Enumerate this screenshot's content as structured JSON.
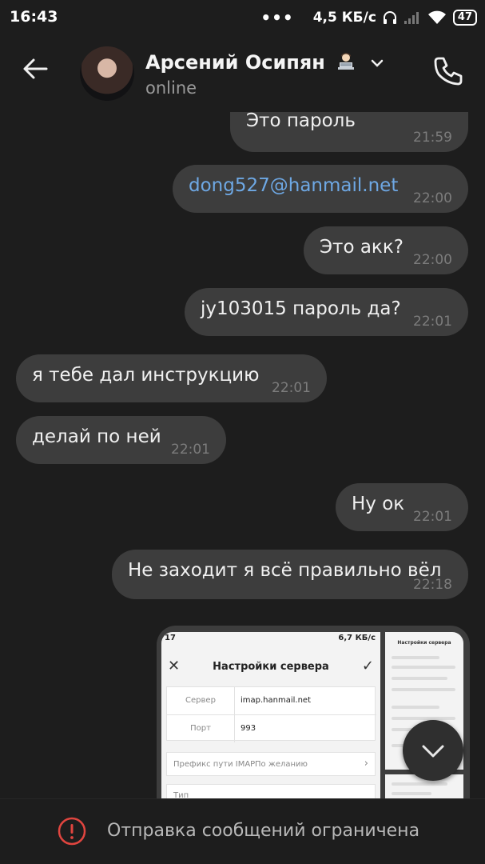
{
  "status_bar": {
    "time": "16:43",
    "dots": "•••",
    "network_speed": "4,5 КБ/с",
    "battery": "47"
  },
  "header": {
    "name": "Арсений Осипян",
    "status": "online",
    "name_emoji": "technologist-emoji"
  },
  "messages": [
    {
      "text": "Это пароль",
      "time": "21:59",
      "side": "out"
    },
    {
      "text": "dong527@hanmail.net",
      "time": "22:00",
      "side": "out",
      "link": true
    },
    {
      "text": "Это акк?",
      "time": "22:00",
      "side": "out"
    },
    {
      "text": "jy103015 пароль да?",
      "time": "22:01",
      "side": "out"
    },
    {
      "text": "я тебе дал инструкцию",
      "time": "22:01",
      "side": "in"
    },
    {
      "text": "делай по ней",
      "time": "22:01",
      "side": "in"
    },
    {
      "text": "Ну ок",
      "time": "22:01",
      "side": "out"
    },
    {
      "text": "Не заходит я всё правильно вёл",
      "time": "22:18",
      "side": "out"
    }
  ],
  "image_message": {
    "status_left": "17",
    "status_right": "6,7 КБ/с",
    "title": "Настройки сервера",
    "rows": [
      {
        "key": "Сервер",
        "value": "imap.hanmail.net"
      },
      {
        "key": "Порт",
        "value": "993"
      }
    ],
    "prefix_key": "Префикс пути IMAP",
    "prefix_value": "По желанию",
    "type_key": "Тип",
    "side_title": "Настройки сервера"
  },
  "footer": {
    "restriction": "Отправка сообщений ограничена"
  },
  "colors": {
    "background": "#1d1d1d",
    "bubble": "#3d3d3d",
    "link": "#6ea8e4",
    "warning": "#e0453f"
  }
}
